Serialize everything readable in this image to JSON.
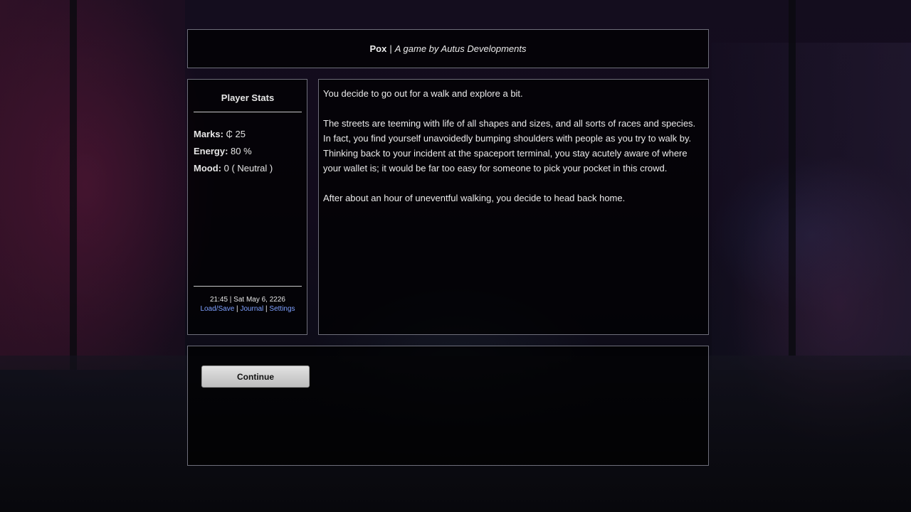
{
  "header": {
    "game_name": "Pox",
    "separator": "|",
    "byline": "A game by Autus Developments"
  },
  "stats": {
    "heading": "Player Stats",
    "marks_label": "Marks:",
    "marks_value": "₵ 25",
    "energy_label": "Energy:",
    "energy_value": "80 %",
    "mood_label": "Mood:",
    "mood_value": "0 ( Neutral )",
    "datetime": "21:45 | Sat May 6, 2226",
    "links": {
      "load_save": "Load/Save",
      "journal": "Journal",
      "settings": "Settings",
      "separator": "|"
    }
  },
  "story": {
    "paragraphs": [
      "You decide to go out for a walk and explore a bit.",
      "The streets are teeming with life of all shapes and sizes, and all sorts of races and species. In fact, you find yourself unavoidedly bumping shoulders with people as you try to walk by. Thinking back to your incident at the spaceport terminal, you stay acutely aware of where your wallet is; it would be far too easy for someone to pick your pocket in this crowd.",
      "After about an hour of uneventful walking, you decide to head back home."
    ]
  },
  "actions": {
    "continue_label": "Continue"
  },
  "colors": {
    "link": "#7ea0ff",
    "panel_border": "#6e6e7a",
    "button_bg": "#d0d0d0"
  }
}
